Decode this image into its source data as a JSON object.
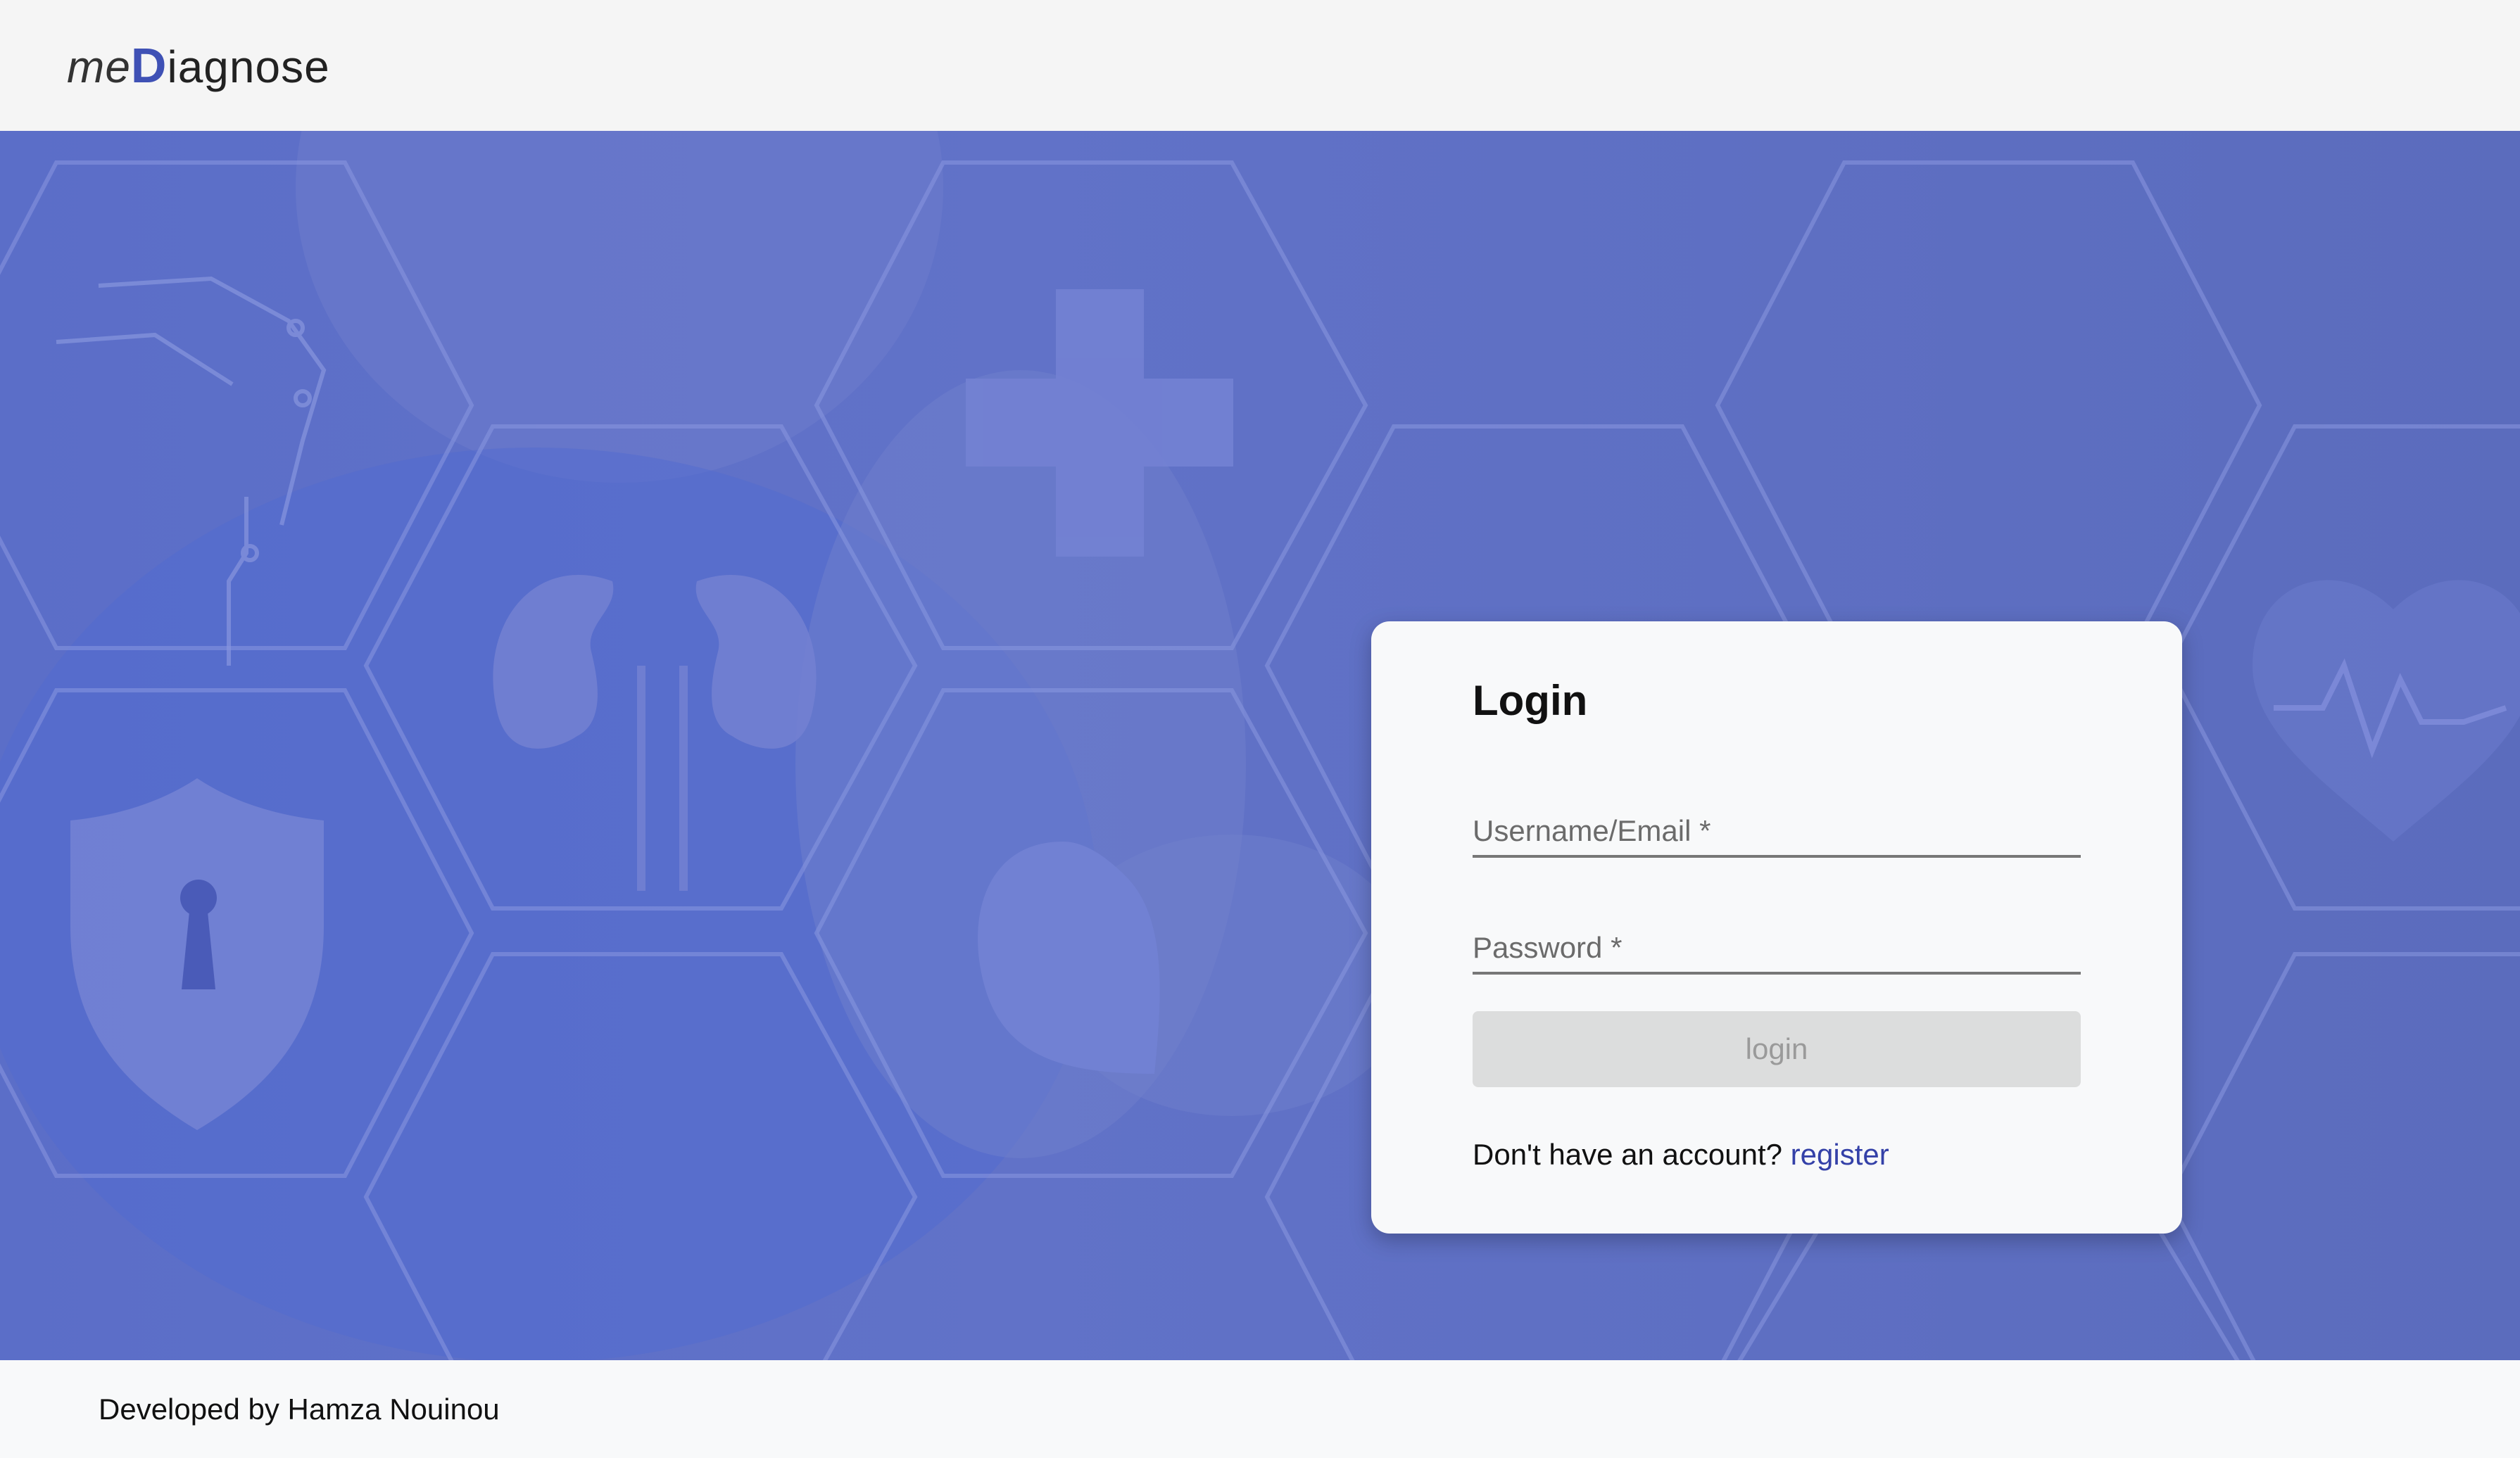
{
  "header": {
    "logo_me": "me",
    "logo_d": "D",
    "logo_rest": "iagnose"
  },
  "colors": {
    "brand": "#3f51b5",
    "hero_overlay": "#5b6ec8",
    "link": "#3441a8",
    "button_disabled_bg": "#dcdddd"
  },
  "login": {
    "title": "Login",
    "username_placeholder": "Username/Email *",
    "password_placeholder": "Password *",
    "button_label": "login",
    "register_prompt": "Don't have an account?",
    "register_link": "register"
  },
  "footer": {
    "credit": "Developed by Hamza Nouinou"
  },
  "icons": [
    "medical-cross-icon",
    "kidneys-icon",
    "heart-icon",
    "shield-lock-icon",
    "circuit-icon",
    "heartbeat-icon"
  ]
}
